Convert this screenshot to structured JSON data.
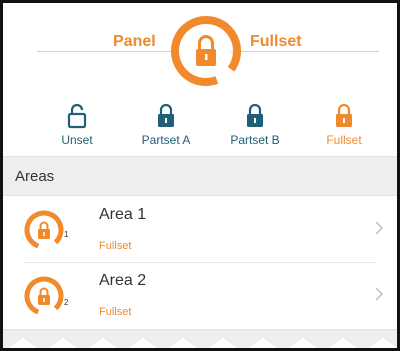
{
  "header": {
    "left_label": "Panel",
    "right_label": "Fullset"
  },
  "modes": [
    {
      "label": "Unset",
      "icon": "unlock-icon",
      "active": false
    },
    {
      "label": "Partset A",
      "icon": "lock-icon",
      "active": false
    },
    {
      "label": "Partset B",
      "icon": "lock-icon",
      "active": false
    },
    {
      "label": "Fullset",
      "icon": "lock-icon",
      "active": true
    }
  ],
  "areas": {
    "title": "Areas",
    "items": [
      {
        "name": "Area 1",
        "number": "1",
        "status": "Fullset"
      },
      {
        "name": "Area 2",
        "number": "2",
        "status": "Fullset"
      }
    ]
  },
  "colors": {
    "accent": "#f08a2c",
    "primary": "#1f5f78",
    "section_bg": "#eeeeee"
  }
}
